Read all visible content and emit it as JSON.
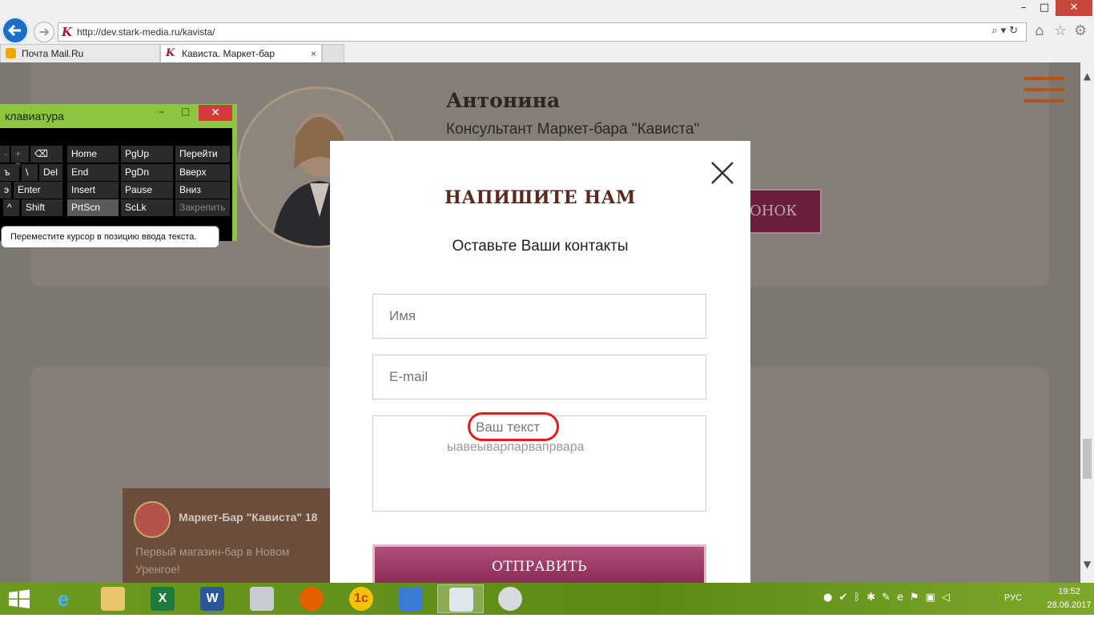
{
  "browser": {
    "url": "http://dev.stark-media.ru/kavista/",
    "tabs": [
      {
        "label": "Почта Mail.Ru",
        "active": false
      },
      {
        "label": "Кависта. Маркет-бар",
        "active": true
      }
    ],
    "close_glyph": "×",
    "window_controls": {
      "minimize": "–",
      "maximize": "□",
      "close": "✕"
    }
  },
  "page": {
    "person_name": "Антонина",
    "person_role": "Консультант Маркет-бара \"Кависта\"",
    "call_button_fragment": "ОНОК",
    "video": {
      "title": "Маркет-Бар \"Кависта\" 18",
      "description": "Первый магазин-бар в Новом Уренгое!"
    }
  },
  "modal": {
    "title": "НАПИШИТЕ НАМ",
    "subtitle": "Оставьте Ваши контакты",
    "name_placeholder": "Имя",
    "email_placeholder": "E-mail",
    "message_placeholder": "Ваш текст",
    "message_value": "ыавеыварпарвапрвара",
    "submit_label": "ОТПРАВИТЬ"
  },
  "osk": {
    "title": "клавиатура",
    "tooltip": "Переместите курсор в позицию ввода текста.",
    "keys": {
      "home": "Home",
      "pgup": "PgUp",
      "goto": "Перейти",
      "hard_sign": "ъ",
      "backslash": "\\",
      "del": "Del",
      "end": "End",
      "pgdn": "PgDn",
      "up": "Вверх",
      "e": "э",
      "enter": "Enter",
      "insert": "Insert",
      "pause": "Pause",
      "down": "Вниз",
      "caret": "^",
      "shift": "Shift",
      "prtscn": "PrtScn",
      "sclk": "ScLk",
      "pin": "Закрепить",
      "dash": "-",
      "plus_eq": "+ =",
      "backspace": "⌫"
    }
  },
  "taskbar": {
    "lang": "РУС",
    "time": "19:52",
    "date": "28.06.2017",
    "apps": [
      "start-icon",
      "ie-icon",
      "file-explorer-icon",
      "excel-icon",
      "word-icon",
      "calculator-icon",
      "firefox-icon",
      "1c-icon",
      "network-tool-icon",
      "on-screen-keyboard-icon",
      "paint-icon"
    ]
  },
  "colors": {
    "accent_brand": "#9b1a4a",
    "submit_top": "#b0507c",
    "submit_bottom": "#84234f",
    "annotation_circle": "#e21b1b",
    "hamburger": "#b75314",
    "osk_frame": "#8cc63f"
  }
}
